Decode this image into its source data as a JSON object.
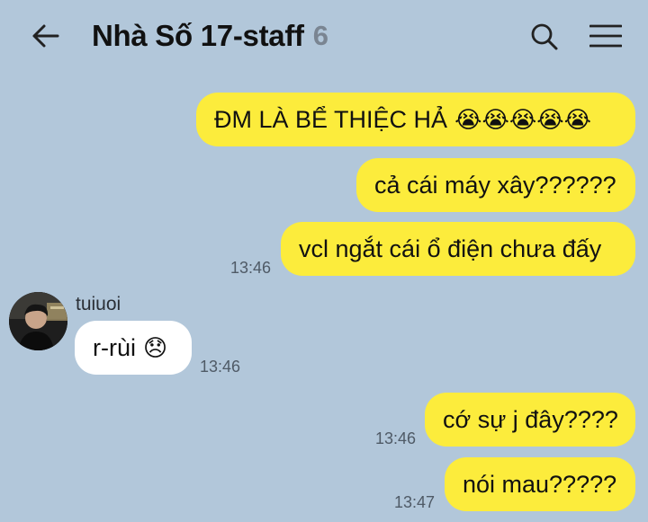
{
  "header": {
    "title": "Nhà Số 17-staff",
    "member_count": "6",
    "icons": {
      "back": "arrow-left-icon",
      "search": "search-icon",
      "menu": "hamburger-menu-icon"
    }
  },
  "colors": {
    "background": "#b2c7da",
    "outgoing_bubble": "#fcec3c",
    "incoming_bubble": "#ffffff"
  },
  "messages": {
    "m1": {
      "text": "ĐM LÀ BỂ THIỆC HẢ",
      "emoji": "😭😭😭😭😭"
    },
    "m2": {
      "text": "cả cái máy xây??????"
    },
    "m3": {
      "text": "vcl ngắt cái ổ điện chưa đấy",
      "time": "13:46"
    },
    "m4": {
      "sender": "tuiuoi",
      "text": "r-rùi",
      "emoji": "😞",
      "time": "13:46"
    },
    "m5": {
      "text": "cớ sự j đây????",
      "time": "13:46"
    },
    "m6": {
      "text": "nói mau?????",
      "time": "13:47"
    }
  }
}
